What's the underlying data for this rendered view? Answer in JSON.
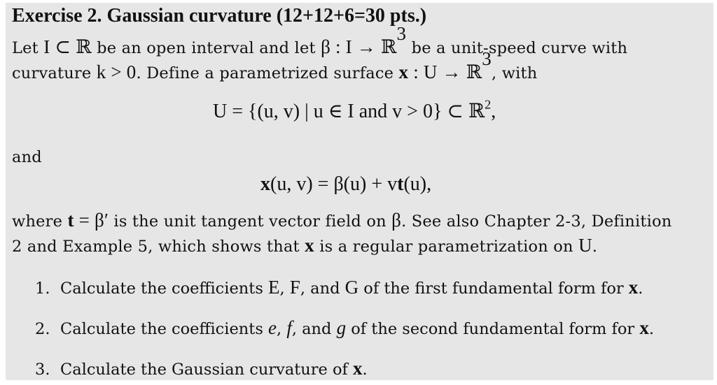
{
  "exercise": {
    "title": "Exercise 2. Gaussian curvature (12+12+6=30 pts.)",
    "intro": {
      "line1": {
        "t1": "Let ",
        "m1": "I ⊂ ℝ",
        "t2": " be an open interval and let ",
        "m2": "β : I → ℝ",
        "m2_sup": "3",
        "t3": " be a unit-speed curve with"
      },
      "line2": {
        "t1": "curvature ",
        "m1": "k > 0",
        "t2": ". Define a parametrized surface ",
        "m2_bold": "x",
        "m2": " : U → ℝ",
        "m2_sup": "3",
        "t3": ", with"
      }
    },
    "display_U": {
      "formula": "U = {(u, v) | u ∈ I and v > 0} ⊂ ℝ",
      "sup": "2",
      "tail": ","
    },
    "and_label": "and",
    "display_x": {
      "lhs_bold": "x",
      "rest1": "(u, v) = β(u) + v",
      "t_bold": "t",
      "rest2": "(u),"
    },
    "where": {
      "line1": {
        "t1": "where ",
        "t_bold": "t",
        "m1": " = β′",
        "t2": " is the unit tangent vector field on ",
        "m2": "β",
        "t3": ". See also Chapter 2-3, Definition"
      },
      "line2": {
        "t1": "2 and Example 5, which shows that ",
        "x_bold": "x",
        "t2": " is a regular parametrization on ",
        "m1": "U",
        "t3": "."
      }
    },
    "items": [
      {
        "num": "1.",
        "t1": "Calculate the coefficients ",
        "m1": "E",
        "t2": ", ",
        "m2": "F",
        "t3": ", and ",
        "m3": "G",
        "t4": " of the first fundamental form for ",
        "x_bold": "x",
        "t5": "."
      },
      {
        "num": "2.",
        "t1": "Calculate the coefficients ",
        "m1": "e",
        "t2": ", ",
        "m2": "f",
        "t3": ", and ",
        "m3": "g",
        "t4": " of the second fundamental form for ",
        "x_bold": "x",
        "t5": "."
      },
      {
        "num": "3.",
        "t1": "Calculate the Gaussian curvature of ",
        "x_bold": "x",
        "t5": "."
      }
    ]
  }
}
